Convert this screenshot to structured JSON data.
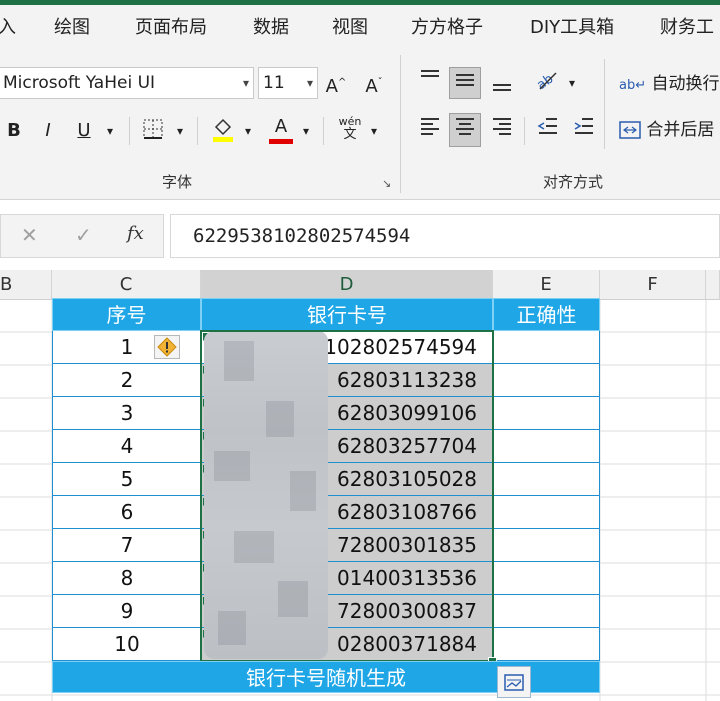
{
  "ribbon_tabs": [
    "入",
    "绘图",
    "页面布局",
    "数据",
    "视图",
    "方方格子",
    "DIY工具箱",
    "财务工"
  ],
  "font": {
    "name": "Microsoft YaHei UI",
    "size": "11"
  },
  "font_buttons": {
    "grow": "A",
    "shrink": "A",
    "bold": "B",
    "italic": "I",
    "underline": "U",
    "font_color": "A",
    "phonetic_top": "wén",
    "phonetic_bottom": "文"
  },
  "groups": {
    "font_label": "字体",
    "align_label": "对齐方式"
  },
  "align_buttons": {
    "wrap_text": "自动换行",
    "merge_center": "合并后居"
  },
  "formula_bar": {
    "cancel": "✕",
    "confirm": "✓",
    "fx": "fx",
    "value": "6229538102802574594"
  },
  "columns": [
    "B",
    "C",
    "D",
    "E",
    "F"
  ],
  "table": {
    "headers": [
      "序号",
      "银行卡号",
      "正确性"
    ],
    "rows": [
      {
        "no": "1",
        "card": "102802574594"
      },
      {
        "no": "2",
        "card": "62803113238"
      },
      {
        "no": "3",
        "card": "62803099106"
      },
      {
        "no": "4",
        "card": "62803257704"
      },
      {
        "no": "5",
        "card": "62803105028"
      },
      {
        "no": "6",
        "card": "62803108766"
      },
      {
        "no": "7",
        "card": "72800301835"
      },
      {
        "no": "8",
        "card": "01400313536"
      },
      {
        "no": "9",
        "card": "72800300837"
      },
      {
        "no": "10",
        "card": "02800371884"
      }
    ],
    "footer": "银行卡号随机生成"
  },
  "colors": {
    "excel_green": "#1e7145",
    "header_blue": "#1ea6e6",
    "selection_gray": "#cdcdcd"
  }
}
